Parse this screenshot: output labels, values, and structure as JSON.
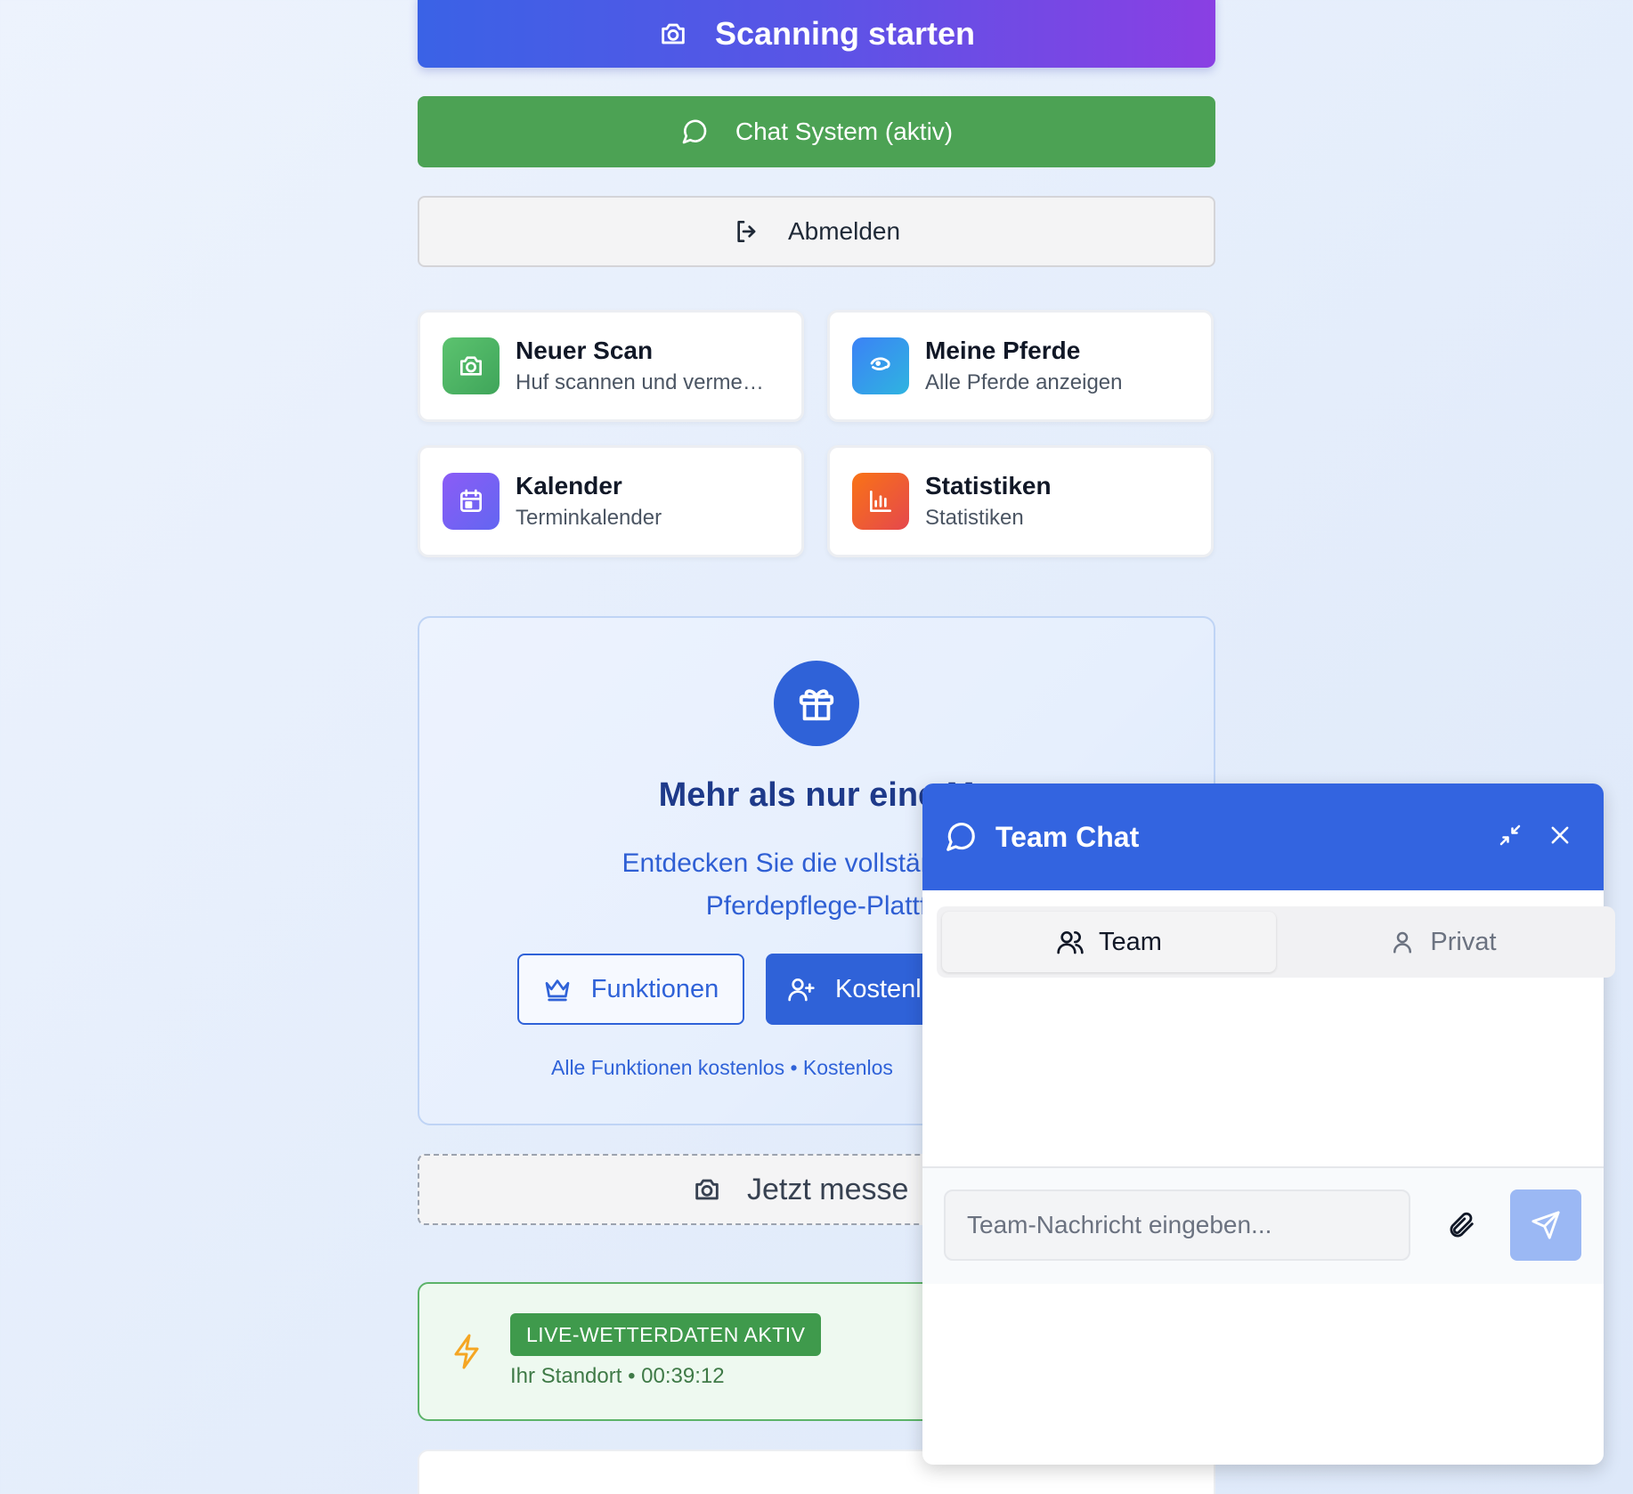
{
  "actions": {
    "scan_label": "Scanning starten",
    "chat_label": "Chat System (aktiv)",
    "logout_label": "Abmelden"
  },
  "cards": [
    {
      "title": "Neuer Scan",
      "subtitle": "Huf scannen und verme…",
      "icon": "camera-icon",
      "color": "#4caf63"
    },
    {
      "title": "Meine Pferde",
      "subtitle": "Alle Pferde anzeigen",
      "icon": "horse-icon",
      "color": "#3b82f6"
    },
    {
      "title": "Kalender",
      "subtitle": "Terminkalender",
      "icon": "calendar-icon",
      "color": "#7c5ce6"
    },
    {
      "title": "Statistiken",
      "subtitle": "Statistiken",
      "icon": "bar-chart-icon",
      "color": "#ee6a2e"
    }
  ],
  "promo": {
    "title": "Mehr als nur eine M",
    "text_line1": "Entdecken Sie die vollständige S",
    "text_line2": "Pferdepflege-Plattf",
    "button_features": "Funktionen",
    "button_free": "Kostenl",
    "footer": "Alle Funktionen kostenlos • Kostenlos"
  },
  "measure": {
    "label": "Jetzt messe"
  },
  "weather": {
    "badge": "LIVE-WETTERDATEN AKTIV",
    "location": "Ihr Standort • 00:39:12"
  },
  "chat": {
    "title": "Team Chat",
    "tabs": [
      {
        "label": "Team",
        "active": true
      },
      {
        "label": "Privat",
        "active": false
      }
    ],
    "input_placeholder": "Team-Nachricht eingeben..."
  },
  "colors": {
    "primary_blue": "#3364e0",
    "chat_green": "#4ca254",
    "scan_gradient_start": "#3a62e6",
    "scan_gradient_end": "#8a3fe3"
  }
}
